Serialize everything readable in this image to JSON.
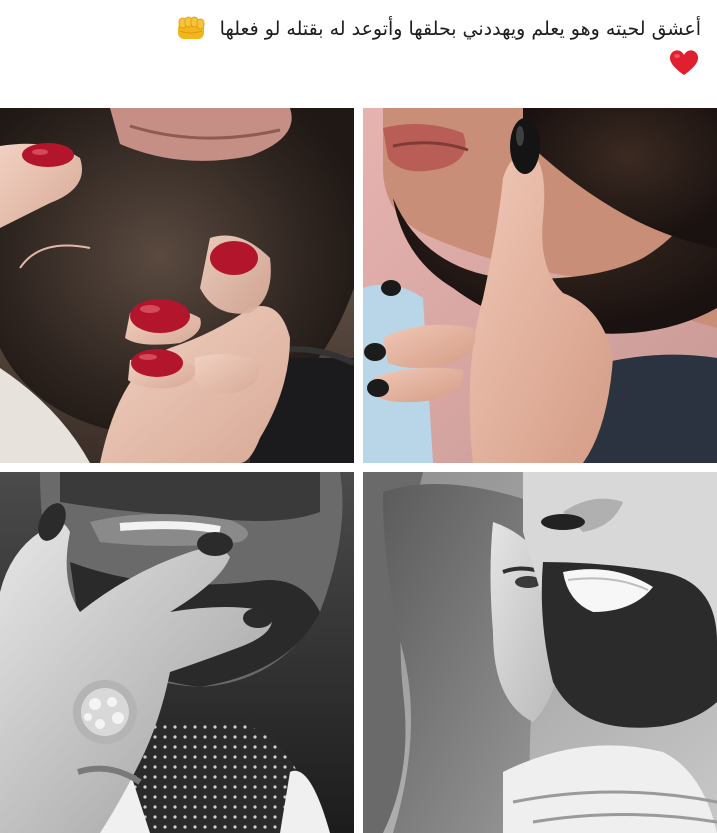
{
  "post": {
    "caption": "أعشق لحيته وهو يعلم ويهددني بحلقها وأتوعد له بقتله لو فعلها",
    "emojis": [
      "fist-emoji",
      "red-heart-emoji"
    ]
  },
  "photos": [
    {
      "name": "photo-red-nails-beard"
    },
    {
      "name": "photo-dark-nails-beard"
    },
    {
      "name": "photo-bw-hand-ring-lips"
    },
    {
      "name": "photo-bw-couple-smiling"
    }
  ],
  "colors": {
    "text": "#1c1e21",
    "background": "#ffffff",
    "nail_red": "#b3162c",
    "heart_red": "#e0202e",
    "fist_yellow": "#f3b51b"
  }
}
